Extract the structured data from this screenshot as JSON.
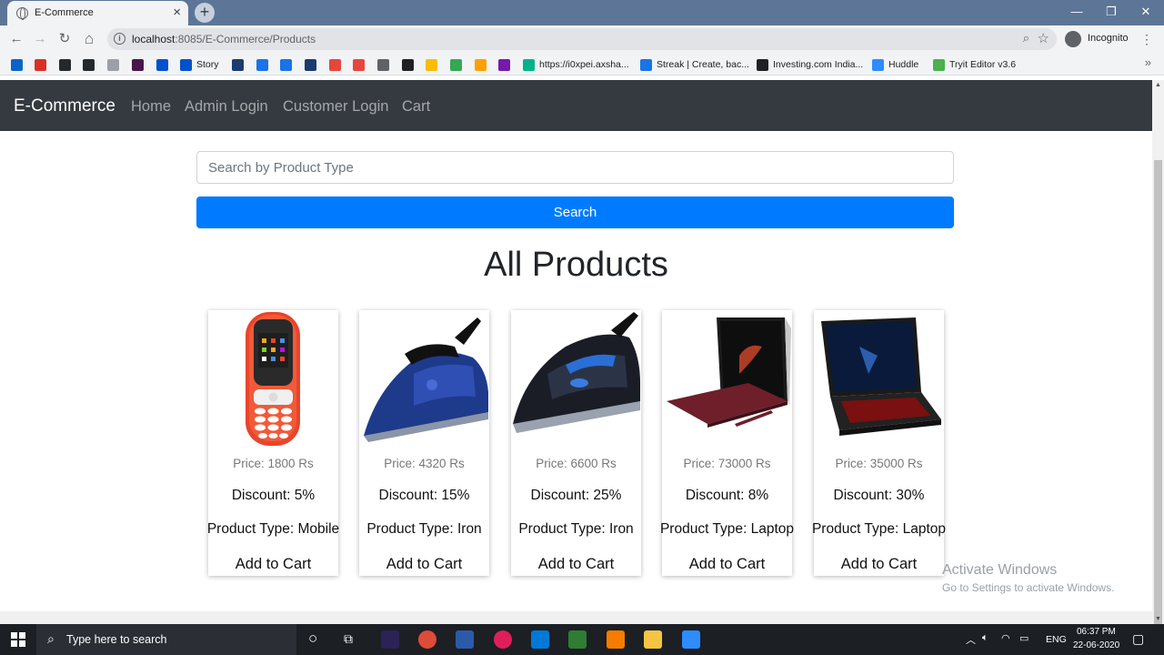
{
  "browser": {
    "tab_title": "E-Commerce",
    "tab_close": "×",
    "new_tab": "+",
    "window_controls": [
      "—",
      "❐",
      "✕"
    ],
    "nav_icons": {
      "back": "←",
      "forward": "→",
      "reload": "↻",
      "home": "⌂"
    },
    "url_host": "localhost",
    "url_path": ":8085/E-Commerce/Products",
    "incognito_label": "Incognito",
    "menu_icon": "⋮",
    "bookmarks": [
      {
        "label": "",
        "icon": "outlook-icon",
        "color": "#0a64c8"
      },
      {
        "label": "",
        "icon": "gmail-icon",
        "color": "#d93025"
      },
      {
        "label": "",
        "icon": "github-icon",
        "color": "#24292e"
      },
      {
        "label": "",
        "icon": "github-icon",
        "color": "#24292e"
      },
      {
        "label": "",
        "icon": "github-icon",
        "color": "#9aa0a6"
      },
      {
        "label": "",
        "icon": "slack-icon",
        "color": "#4a154b"
      },
      {
        "label": "",
        "icon": "jira-icon",
        "color": "#0052cc"
      },
      {
        "label": "Story",
        "icon": "atlassian-icon",
        "color": "#0052cc"
      },
      {
        "label": "",
        "icon": "robot-icon",
        "color": "#1a3c6e"
      },
      {
        "label": "",
        "icon": "confluence-icon",
        "color": "#1a73e8"
      },
      {
        "label": "",
        "icon": "jira-icon",
        "color": "#1a73e8"
      },
      {
        "label": "",
        "icon": "robot-icon",
        "color": "#1a3c6e"
      },
      {
        "label": "",
        "icon": "codeigniter-icon",
        "color": "#e8453c"
      },
      {
        "label": "",
        "icon": "codeigniter-icon",
        "color": "#e8453c"
      },
      {
        "label": "",
        "icon": "dots-icon",
        "color": "#5f6368"
      },
      {
        "label": "",
        "icon": "cb-icon",
        "color": "#202124"
      },
      {
        "label": "",
        "icon": "keep-icon",
        "color": "#fbbc04"
      },
      {
        "label": "",
        "icon": "drive-icon",
        "color": "#34a853"
      },
      {
        "label": "",
        "icon": "firebase-icon",
        "color": "#ffa000"
      },
      {
        "label": "",
        "icon": "onenote-icon",
        "color": "#7719aa"
      },
      {
        "label": "https://i0xpei.axsha...",
        "icon": "play-icon",
        "color": "#00b388"
      },
      {
        "label": "Streak | Create, bac...",
        "icon": "streak-icon",
        "color": "#1a73e8"
      },
      {
        "label": "Investing.com India...",
        "icon": "investing-icon",
        "color": "#202124"
      },
      {
        "label": "Huddle",
        "icon": "zoom-icon",
        "color": "#2d8cff"
      },
      {
        "label": "Tryit Editor v3.6",
        "icon": "w3-icon",
        "color": "#4caf50"
      }
    ],
    "bookmarks_more": "»"
  },
  "navbar": {
    "brand": "E-Commerce",
    "links": [
      "Home",
      "Admin Login",
      "Customer Login",
      "Cart"
    ]
  },
  "search": {
    "placeholder": "Search by Product Type",
    "button_label": "Search"
  },
  "page_title": "All Products",
  "products": [
    {
      "price": "Price: 1800 Rs",
      "discount": "Discount: 5%",
      "type": "Product Type: Mobile",
      "action": "Add to Cart"
    },
    {
      "price": "Price: 4320 Rs",
      "discount": "Discount: 15%",
      "type": "Product Type: Iron",
      "action": "Add to Cart"
    },
    {
      "price": "Price: 6600 Rs",
      "discount": "Discount: 25%",
      "type": "Product Type: Iron",
      "action": "Add to Cart"
    },
    {
      "price": "Price: 73000 Rs",
      "discount": "Discount: 8%",
      "type": "Product Type: Laptop",
      "action": "Add to Cart"
    },
    {
      "price": "Price: 35000 Rs",
      "discount": "Discount: 30%",
      "type": "Product Type: Laptop",
      "action": "Add to Cart"
    }
  ],
  "watermark": {
    "line1": "Activate Windows",
    "line2": "Go to Settings to activate Windows."
  },
  "taskbar": {
    "search_placeholder": "Type here to search",
    "language": "ENG",
    "time": "06:37 PM",
    "date": "22-06-2020"
  }
}
